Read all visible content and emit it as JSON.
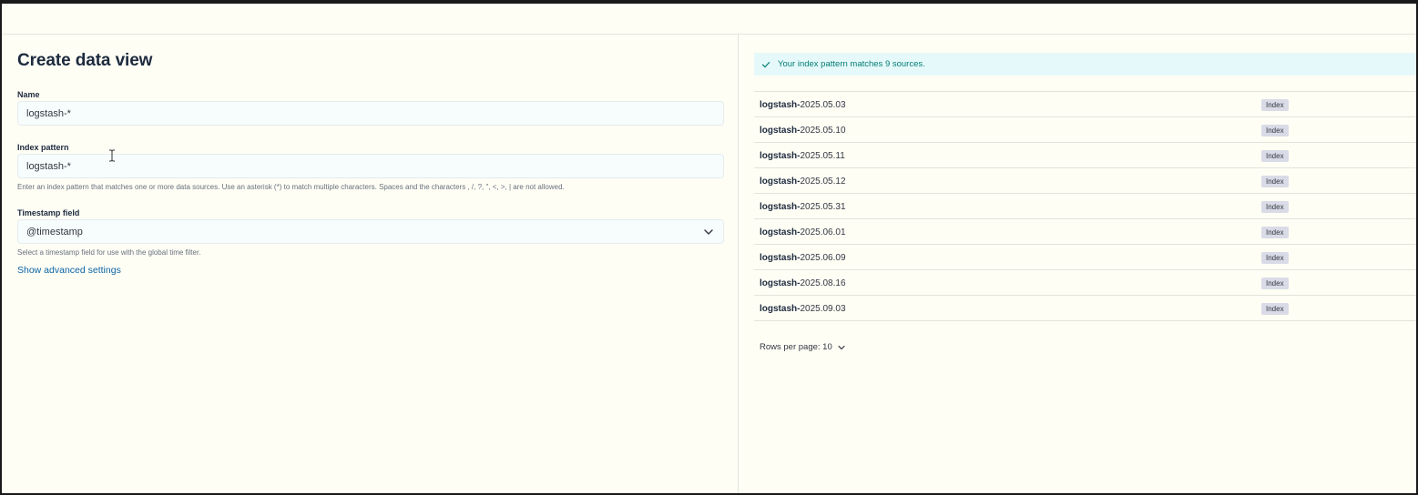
{
  "form": {
    "title": "Create data view",
    "name": {
      "label": "Name",
      "value": "logstash-*"
    },
    "index_pattern": {
      "label": "Index pattern",
      "value": "logstash-*",
      "help": "Enter an index pattern that matches one or more data sources. Use an asterisk (*) to match multiple characters. Spaces and the characters , /, ?, \", <, >, | are not allowed."
    },
    "timestamp_field": {
      "label": "Timestamp field",
      "value": "@timestamp",
      "help": "Select a timestamp field for use with the global time filter."
    },
    "advanced_link": "Show advanced settings"
  },
  "results": {
    "callout": "Your index pattern matches 9 sources.",
    "rows": [
      {
        "prefix": "logstash-",
        "suffix": "2025.05.03",
        "badge": "Index"
      },
      {
        "prefix": "logstash-",
        "suffix": "2025.05.10",
        "badge": "Index"
      },
      {
        "prefix": "logstash-",
        "suffix": "2025.05.11",
        "badge": "Index"
      },
      {
        "prefix": "logstash-",
        "suffix": "2025.05.12",
        "badge": "Index"
      },
      {
        "prefix": "logstash-",
        "suffix": "2025.05.31",
        "badge": "Index"
      },
      {
        "prefix": "logstash-",
        "suffix": "2025.06.01",
        "badge": "Index"
      },
      {
        "prefix": "logstash-",
        "suffix": "2025.06.09",
        "badge": "Index"
      },
      {
        "prefix": "logstash-",
        "suffix": "2025.08.16",
        "badge": "Index"
      },
      {
        "prefix": "logstash-",
        "suffix": "2025.09.03",
        "badge": "Index"
      }
    ],
    "rows_per_page": "Rows per page: 10"
  },
  "colors": {
    "accent_link": "#0b64a5",
    "success_text": "#017d73",
    "callout_bg": "#e6f9fa"
  },
  "icons": {
    "callout": "check-icon",
    "select": "chevron-down-icon",
    "pagination": "chevron-down-icon",
    "cursor": "text-cursor-icon"
  }
}
